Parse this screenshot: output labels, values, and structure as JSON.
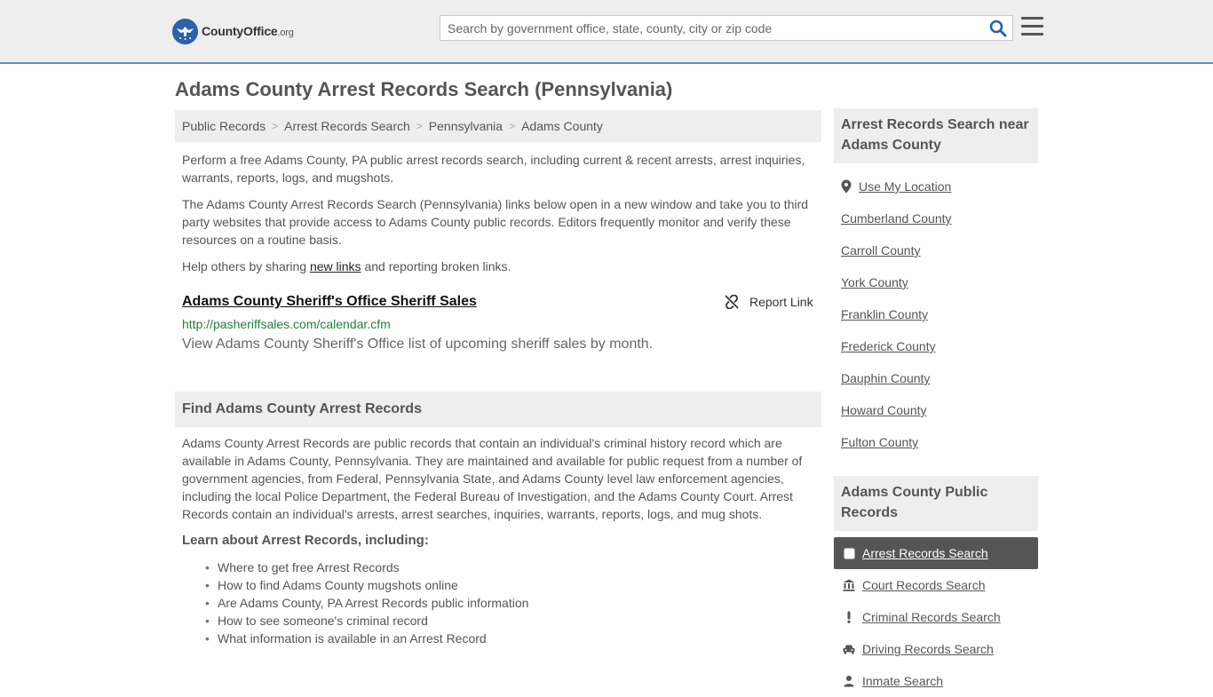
{
  "header": {
    "logo_name": "CountyOffice",
    "logo_tld": ".org",
    "search_placeholder": "Search by government office, state, county, city or zip code"
  },
  "page_title": "Adams County Arrest Records Search (Pennsylvania)",
  "breadcrumb": [
    "Public Records",
    "Arrest Records Search",
    "Pennsylvania",
    "Adams County"
  ],
  "breadcrumb_sep": ">",
  "intro": {
    "p1": "Perform a free Adams County, PA public arrest records search, including current & recent arrests, arrest inquiries, warrants, reports, logs, and mugshots.",
    "p2": "The Adams County Arrest Records Search (Pennsylvania) links below open in a new window and take you to third party websites that provide access to Adams County public records. Editors frequently monitor and verify these resources on a routine basis.",
    "p3_before": "Help others by sharing ",
    "p3_link": "new links",
    "p3_after": " and reporting broken links."
  },
  "listing": {
    "title": "Adams County Sheriff's Office Sheriff Sales",
    "url": "http://pasheriffsales.com/calendar.cfm",
    "description": "View Adams County Sheriff's Office list of upcoming sheriff sales by month.",
    "report_label": "Report Link"
  },
  "find_section": {
    "heading": "Find Adams County Arrest Records",
    "body": "Adams County Arrest Records are public records that contain an individual's criminal history record which are available in Adams County, Pennsylvania. They are maintained and available for public request from a number of government agencies, from Federal, Pennsylvania State, and Adams County level law enforcement agencies, including the local Police Department, the Federal Bureau of Investigation, and the Adams County Court. Arrest Records contain an individual's arrests, arrest searches, inquiries, warrants, reports, logs, and mug shots.",
    "learn_heading": "Learn about Arrest Records, including:",
    "learn_items": [
      "Where to get free Arrest Records",
      "How to find Adams County mugshots online",
      "Are Adams County, PA Arrest Records public information",
      "How to see someone's criminal record",
      "What information is available in an Arrest Record"
    ]
  },
  "sidebar": {
    "nearby_heading": "Arrest Records Search near Adams County",
    "use_location": "Use My Location",
    "nearby_counties": [
      "Cumberland County",
      "Carroll County",
      "York County",
      "Franklin County",
      "Frederick County",
      "Dauphin County",
      "Howard County",
      "Fulton County"
    ],
    "public_records_heading": "Adams County Public Records",
    "public_records": [
      {
        "label": "Arrest Records Search",
        "icon": "square-icon",
        "active": true
      },
      {
        "label": "Court Records Search",
        "icon": "courthouse-icon",
        "active": false
      },
      {
        "label": "Criminal Records Search",
        "icon": "exclamation-icon",
        "active": false
      },
      {
        "label": "Driving Records Search",
        "icon": "car-icon",
        "active": false
      },
      {
        "label": "Inmate Search",
        "icon": "inmate-icon",
        "active": false
      }
    ]
  },
  "colors": {
    "header_bg": "#eeeeee",
    "header_border": "#5a8fc6",
    "search_icon": "#2b62a8",
    "url_green": "#2a7d3a",
    "active_bg": "#555555"
  }
}
